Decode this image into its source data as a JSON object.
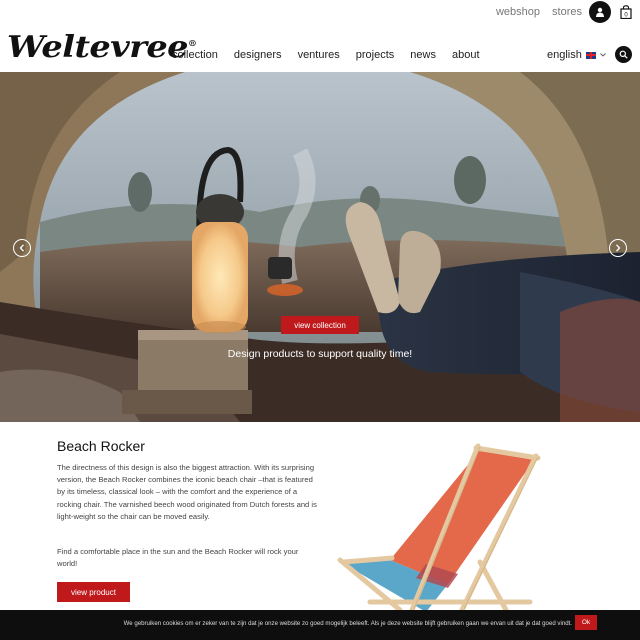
{
  "header": {
    "top_links": [
      "webshop",
      "stores"
    ],
    "logo": "Weltevree",
    "logo_mark": "®",
    "nav": [
      "collection",
      "designers",
      "ventures",
      "projects",
      "news",
      "about"
    ],
    "language": "english"
  },
  "hero": {
    "button_label": "view collection",
    "tagline": "Design products to support quality time!"
  },
  "product": {
    "title": "Beach Rocker",
    "paragraph1": "The directness of this design is also the biggest attraction. With its surprising version, the Beach Rocker combines the iconic beach chair –that is featured by its timeless, classical look – with the comfort and the experience of a rocking chair. The varnished beech wood originated from Dutch forests and is light-weight so the chair can be moved easily.",
    "paragraph2": "Find a comfortable place in the sun and the Beach Rocker will rock your world!",
    "button_label": "view product"
  },
  "cookie": {
    "text": "We gebruiken cookies om er zeker van te zijn dat je onze website zo goed mogelijk beleeft. Als je deze website blijft gebruiken gaan we ervan uit dat je dat goed vindt.",
    "button_label": "Ok"
  },
  "colors": {
    "accent": "#c0191b"
  }
}
